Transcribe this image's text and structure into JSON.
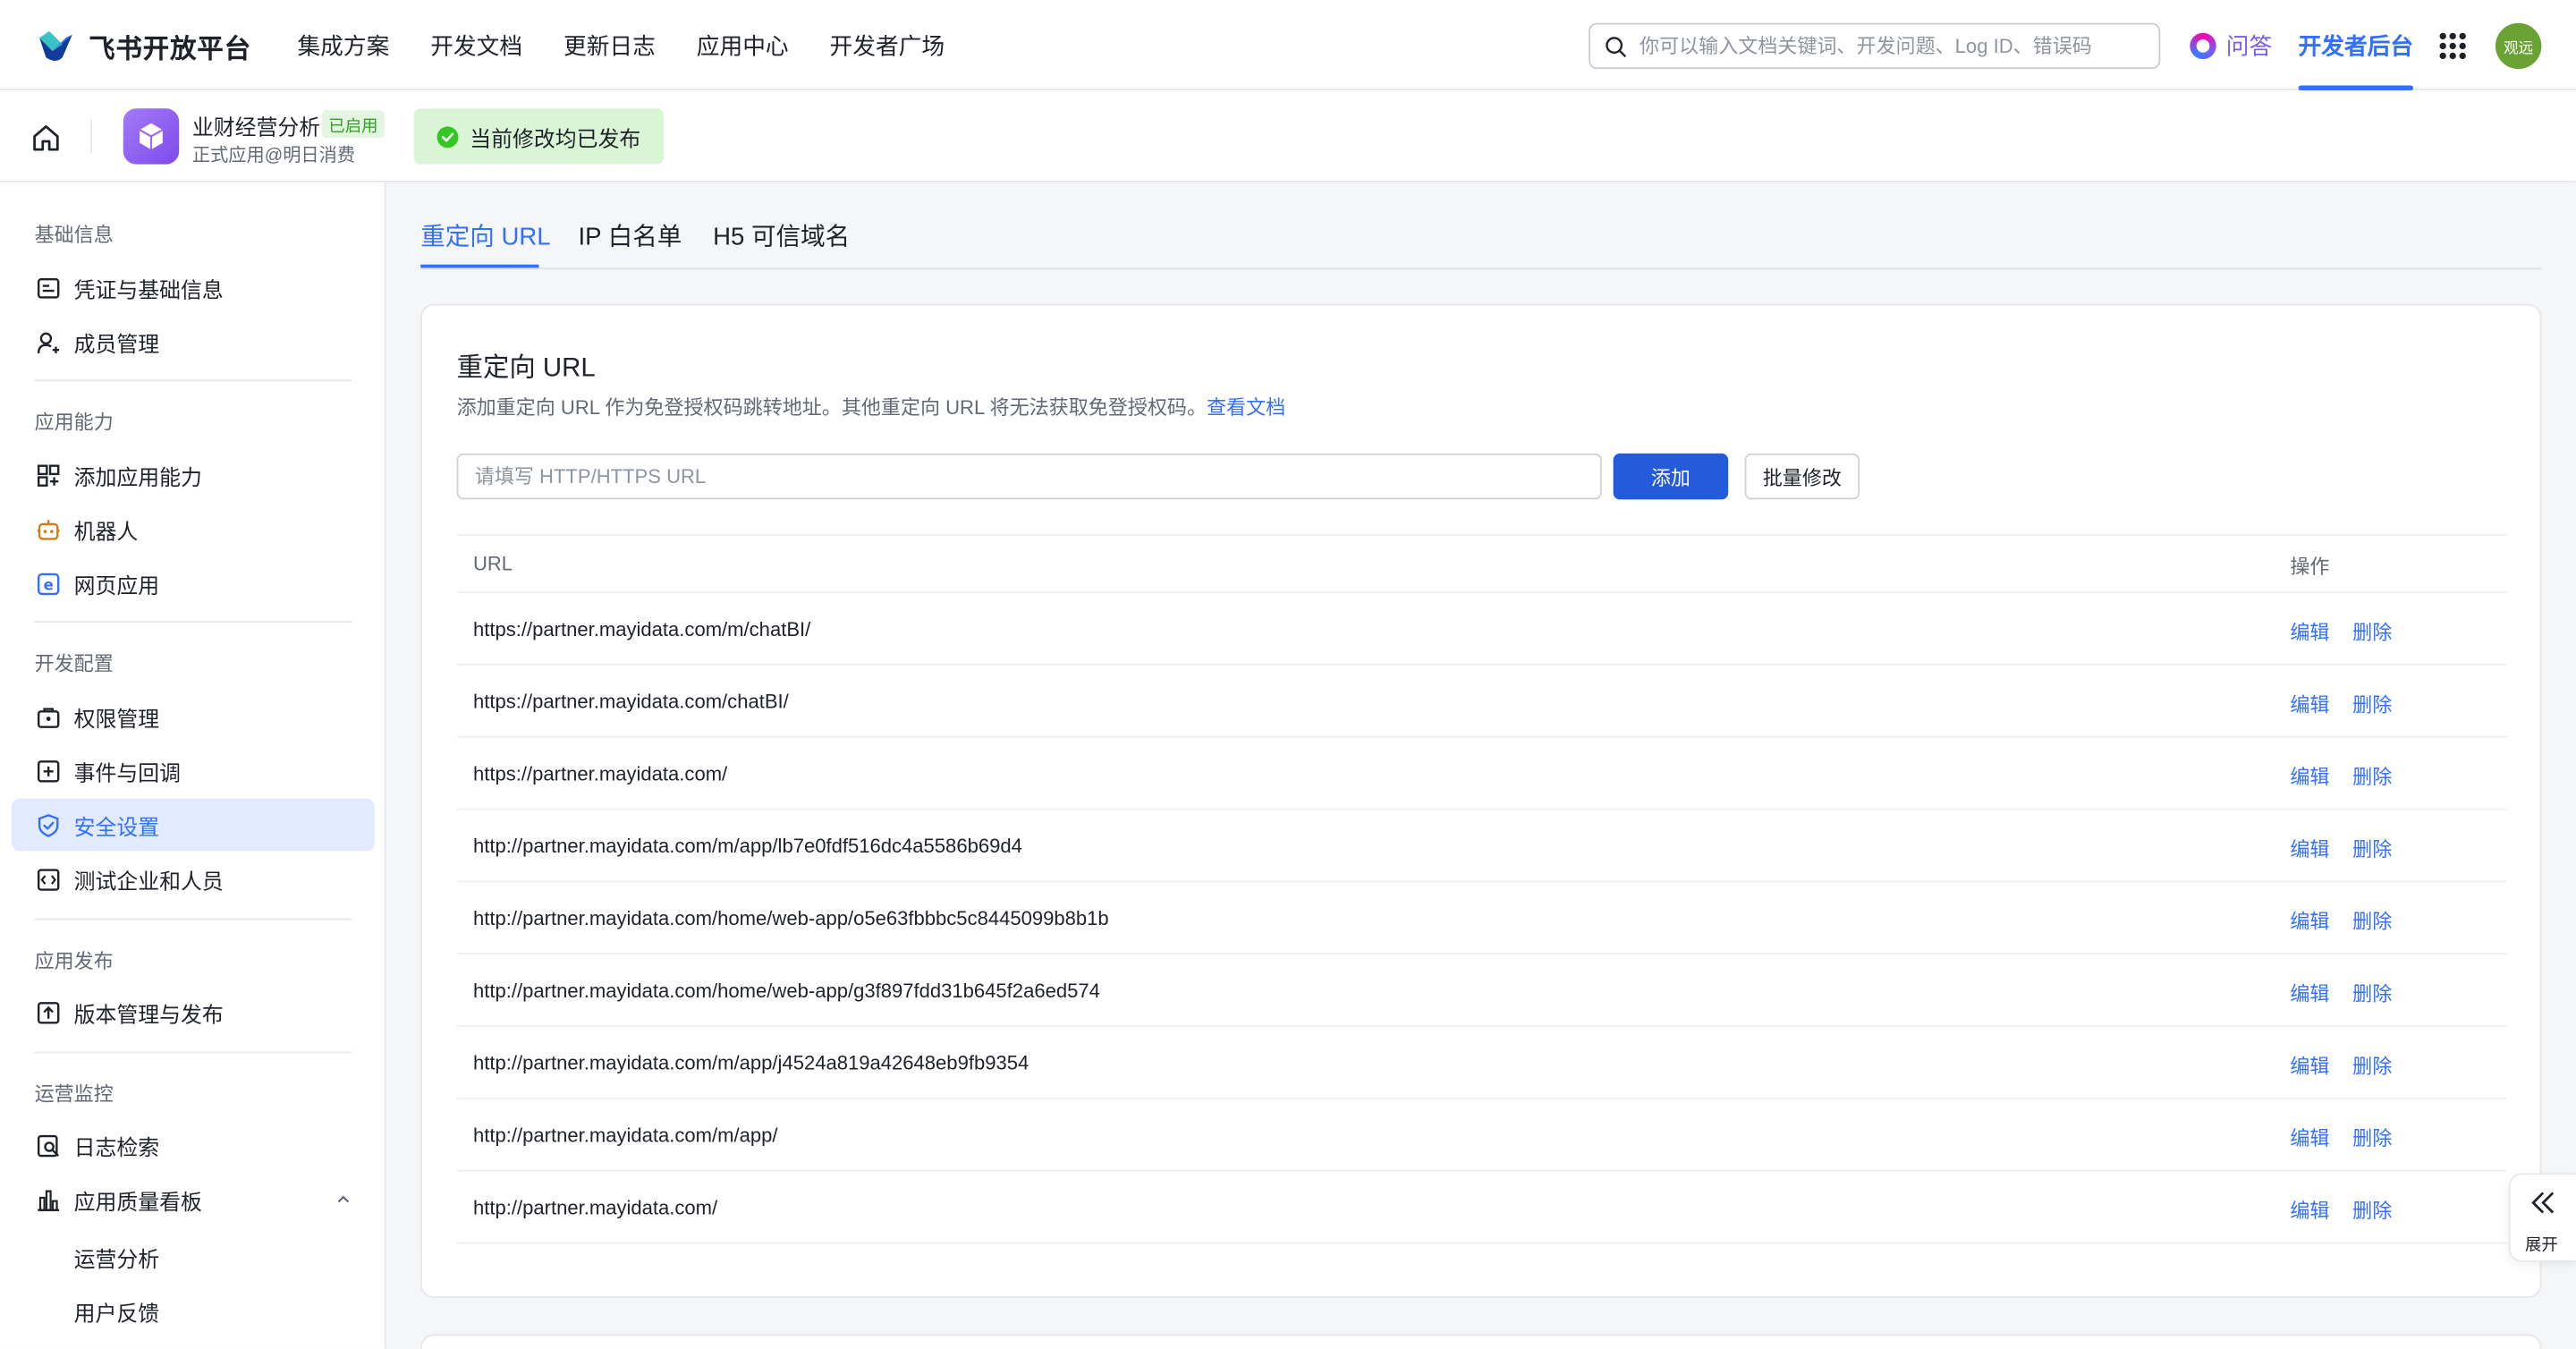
{
  "brand": {
    "name": "飞书开放平台",
    "colors": {
      "accent": "#3370ff",
      "success": "#34c724",
      "ai": "#7a5af8"
    }
  },
  "nav": {
    "items": [
      "集成方案",
      "开发文档",
      "更新日志",
      "应用中心",
      "开发者广场"
    ]
  },
  "search": {
    "placeholder": "你可以输入文档关键词、开发问题、Log ID、错误码",
    "icon": "search-icon"
  },
  "qa_label": "问答",
  "dev_console_label": "开发者后台",
  "avatar_text": "观远",
  "app": {
    "name": "业财经营分析",
    "status": "已启用",
    "subtitle": "正式应用@明日消费",
    "publish_status": "当前修改均已发布"
  },
  "sidebar": {
    "sections": [
      {
        "title": "基础信息",
        "items": [
          {
            "label": "凭证与基础信息",
            "icon": "credential-icon"
          },
          {
            "label": "成员管理",
            "icon": "member-icon"
          }
        ]
      },
      {
        "title": "应用能力",
        "items": [
          {
            "label": "添加应用能力",
            "icon": "add-capability-icon"
          },
          {
            "label": "机器人",
            "icon": "robot-icon"
          },
          {
            "label": "网页应用",
            "icon": "web-app-icon"
          }
        ]
      },
      {
        "title": "开发配置",
        "items": [
          {
            "label": "权限管理",
            "icon": "permission-icon"
          },
          {
            "label": "事件与回调",
            "icon": "event-icon"
          },
          {
            "label": "安全设置",
            "icon": "shield-icon",
            "active": true
          },
          {
            "label": "测试企业和人员",
            "icon": "test-icon"
          }
        ]
      },
      {
        "title": "应用发布",
        "items": [
          {
            "label": "版本管理与发布",
            "icon": "publish-icon"
          }
        ]
      },
      {
        "title": "运营监控",
        "items": [
          {
            "label": "日志检索",
            "icon": "log-search-icon"
          },
          {
            "label": "应用质量看板",
            "icon": "dashboard-icon",
            "expanded": true,
            "children": [
              "运营分析",
              "用户反馈"
            ]
          }
        ]
      }
    ]
  },
  "tabs": [
    "重定向 URL",
    "IP 白名单",
    "H5 可信域名"
  ],
  "card": {
    "title": "重定向 URL",
    "description": "添加重定向 URL 作为免登授权码跳转地址。其他重定向 URL 将无法获取免登授权码。",
    "doc_link": "查看文档",
    "input_placeholder": "请填写 HTTP/HTTPS URL",
    "add_label": "添加",
    "batch_label": "批量修改",
    "table": {
      "columns": [
        "URL",
        "操作"
      ],
      "actions": {
        "edit": "编辑",
        "delete": "删除"
      },
      "rows": [
        "https://partner.mayidata.com/m/chatBI/",
        "https://partner.mayidata.com/chatBI/",
        "https://partner.mayidata.com/",
        "http://partner.mayidata.com/m/app/lb7e0fdf516dc4a5586b69d4",
        "http://partner.mayidata.com/home/web-app/o5e63fbbbc5c8445099b8b1b",
        "http://partner.mayidata.com/home/web-app/g3f897fdd31b645f2a6ed574",
        "http://partner.mayidata.com/m/app/j4524a819a42648eb9fb9354",
        "http://partner.mayidata.com/m/app/",
        "http://partner.mayidata.com/"
      ]
    }
  },
  "expand_label": "展开"
}
